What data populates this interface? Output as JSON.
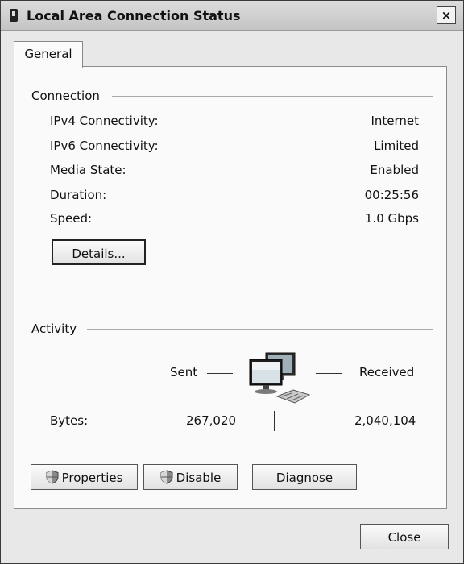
{
  "window": {
    "title": "Local Area Connection Status",
    "close_glyph": "×"
  },
  "tabs": [
    {
      "label": "General",
      "selected": true
    }
  ],
  "connection": {
    "header": "Connection",
    "rows": [
      {
        "label": "IPv4 Connectivity:",
        "value": "Internet"
      },
      {
        "label": "IPv6 Connectivity:",
        "value": "Limited"
      },
      {
        "label": "Media State:",
        "value": "Enabled"
      },
      {
        "label": "Duration:",
        "value": "00:25:56"
      },
      {
        "label": "Speed:",
        "value": "1.0 Gbps"
      }
    ],
    "details_button": "Details..."
  },
  "activity": {
    "header": "Activity",
    "sent_label": "Sent",
    "received_label": "Received",
    "bytes_label": "Bytes:",
    "bytes_sent": "267,020",
    "bytes_received": "2,040,104"
  },
  "buttons": {
    "properties": "Properties",
    "disable": "Disable",
    "diagnose": "Diagnose",
    "close": "Close"
  },
  "icons": {
    "title": "network-adapter-icon",
    "activity": "network-computers-icon",
    "shield": "uac-shield-icon"
  }
}
